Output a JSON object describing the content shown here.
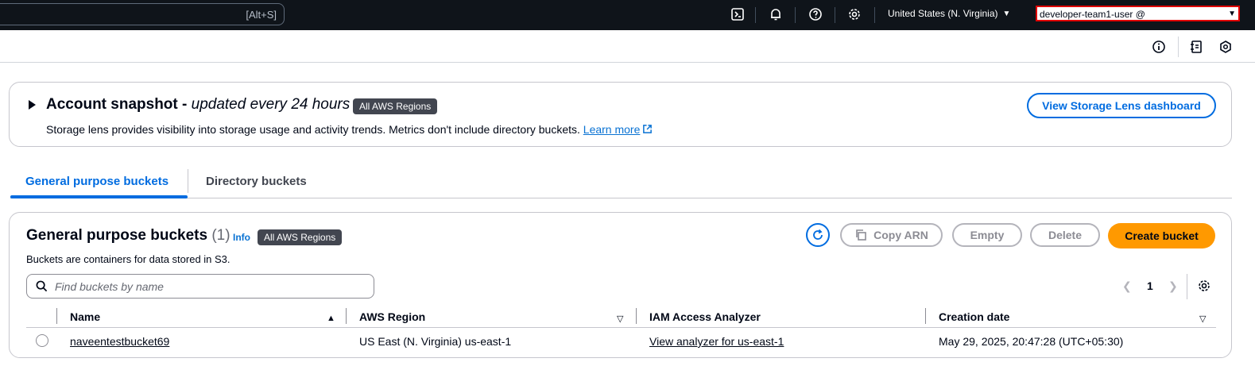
{
  "topbar": {
    "search_shortcut": "[Alt+S]",
    "region": "United States (N. Virginia)",
    "account": "developer-team1-user @"
  },
  "snapshot": {
    "title": "Account snapshot -",
    "title_italic": "updated every 24 hours",
    "badge": "All AWS Regions",
    "description": "Storage lens provides visibility into storage usage and activity trends. Metrics don't include directory buckets.",
    "learn_more": "Learn more",
    "dashboard_button": "View Storage Lens dashboard"
  },
  "tabs": [
    {
      "label": "General purpose buckets",
      "active": true
    },
    {
      "label": "Directory buckets",
      "active": false
    }
  ],
  "buckets": {
    "title": "General purpose buckets",
    "count": "(1)",
    "info": "Info",
    "badge": "All AWS Regions",
    "description": "Buckets are containers for data stored in S3.",
    "copy_arn": "Copy ARN",
    "empty": "Empty",
    "delete": "Delete",
    "create": "Create bucket",
    "search_placeholder": "Find buckets by name",
    "page": "1",
    "columns": [
      "Name",
      "AWS Region",
      "IAM Access Analyzer",
      "Creation date"
    ],
    "rows": [
      {
        "name": "naveentestbucket69",
        "region": "US East (N. Virginia) us-east-1",
        "analyzer": "View analyzer for us-east-1",
        "created": "May 29, 2025, 20:47:28 (UTC+05:30)"
      }
    ]
  },
  "colors": {
    "topbar_bg": "#0f141a",
    "accent": "#006ce0",
    "primary_button": "#ff9900",
    "badge_bg": "#424650"
  }
}
